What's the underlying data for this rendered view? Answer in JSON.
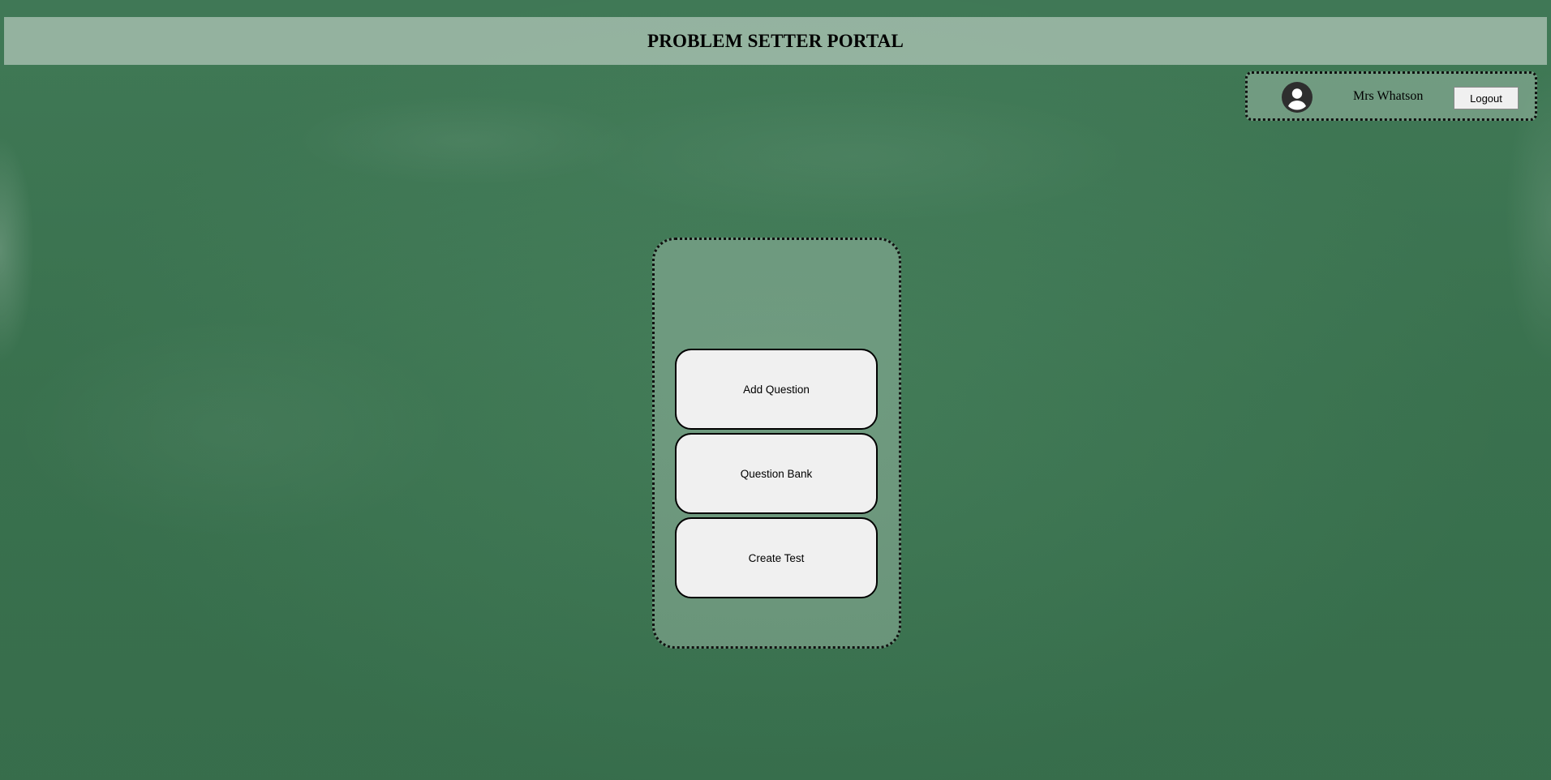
{
  "header": {
    "title": "PROBLEM SETTER PORTAL"
  },
  "user_panel": {
    "avatar_icon": "user-avatar-icon",
    "user_name": "Mrs Whatson",
    "logout_label": "Logout"
  },
  "menu": {
    "items": [
      {
        "label": "Add Question"
      },
      {
        "label": "Question Bank"
      },
      {
        "label": "Create Test"
      }
    ]
  },
  "colors": {
    "background": "#3f7a56",
    "header_bar": "#a3bba9",
    "button_fill": "#f0f0f0",
    "border": "#111111"
  }
}
